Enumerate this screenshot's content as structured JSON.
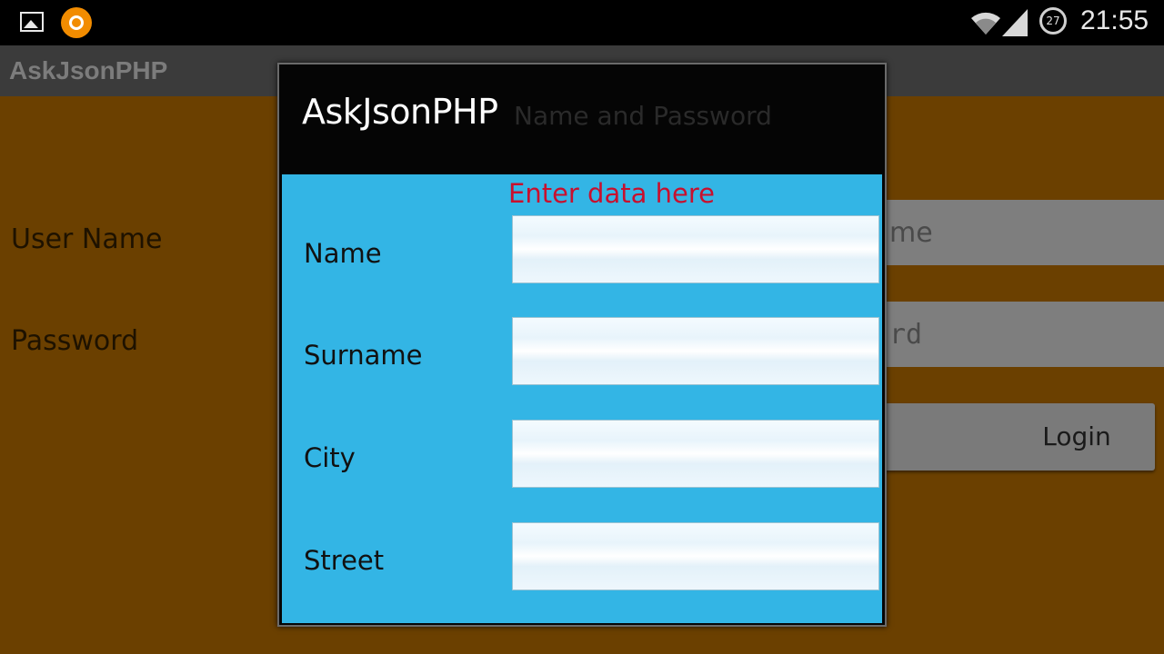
{
  "status_bar": {
    "time": "21:55",
    "battery_level": "27",
    "icons": [
      "gallery-icon",
      "app-notification-icon",
      "wifi-icon",
      "signal-icon",
      "battery-icon"
    ]
  },
  "background_activity": {
    "app_title": "AskJsonPHP",
    "user_name_label": "User Name",
    "password_label": "Password",
    "user_name_hint_fragment": "me",
    "password_hint_fragment": "rd",
    "login_button": "Login",
    "content_color": "#f08c00"
  },
  "dialog": {
    "title": "AskJsonPHP",
    "ghost_text": "Name and Password",
    "hint": "Enter data here",
    "body_color": "#33b5e5",
    "fields": [
      {
        "label": "Name",
        "value": ""
      },
      {
        "label": "Surname",
        "value": ""
      },
      {
        "label": "City",
        "value": ""
      },
      {
        "label": "Street",
        "value": ""
      }
    ]
  }
}
